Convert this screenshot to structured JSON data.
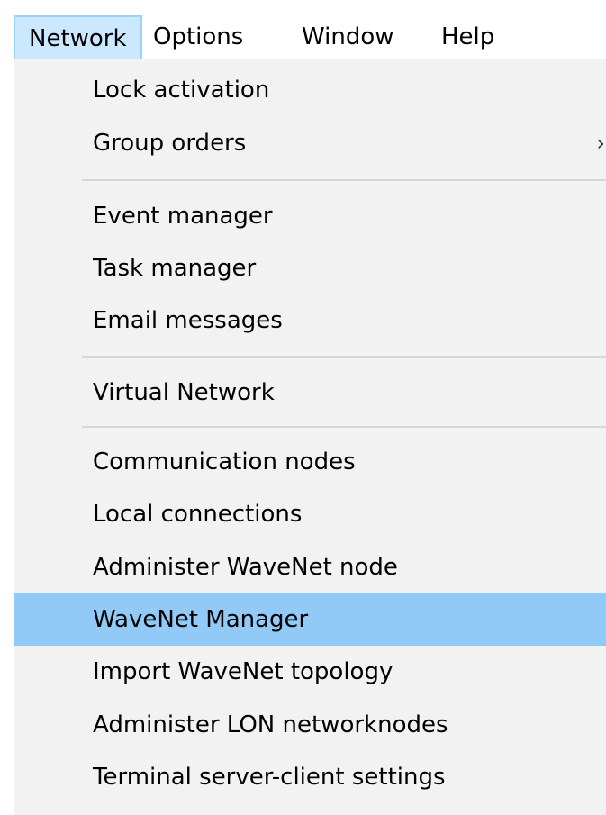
{
  "menubar": {
    "items": [
      {
        "label": "Network",
        "open": true
      },
      {
        "label": "Options",
        "open": false
      },
      {
        "label": "Window",
        "open": false
      },
      {
        "label": "Help",
        "open": false
      }
    ]
  },
  "dropdown": {
    "items": [
      {
        "label": "Lock activation"
      },
      {
        "label": "Group orders",
        "submenu_icon": "›"
      },
      {
        "label": "Event manager"
      },
      {
        "label": "Task manager"
      },
      {
        "label": "Email messages"
      },
      {
        "label": "Virtual Network"
      },
      {
        "label": "Communication nodes"
      },
      {
        "label": "Local connections"
      },
      {
        "label": "Administer WaveNet node"
      },
      {
        "label": "WaveNet Manager",
        "highlighted": true
      },
      {
        "label": "Import WaveNet topology"
      },
      {
        "label": "Administer LON networknodes"
      },
      {
        "label": "Terminal server-client settings"
      }
    ]
  },
  "colors": {
    "menu_background": "#f2f2f2",
    "open_menu_background": "#cce8ff",
    "highlight": "#91c9f7",
    "separator": "#d7d7d7"
  }
}
